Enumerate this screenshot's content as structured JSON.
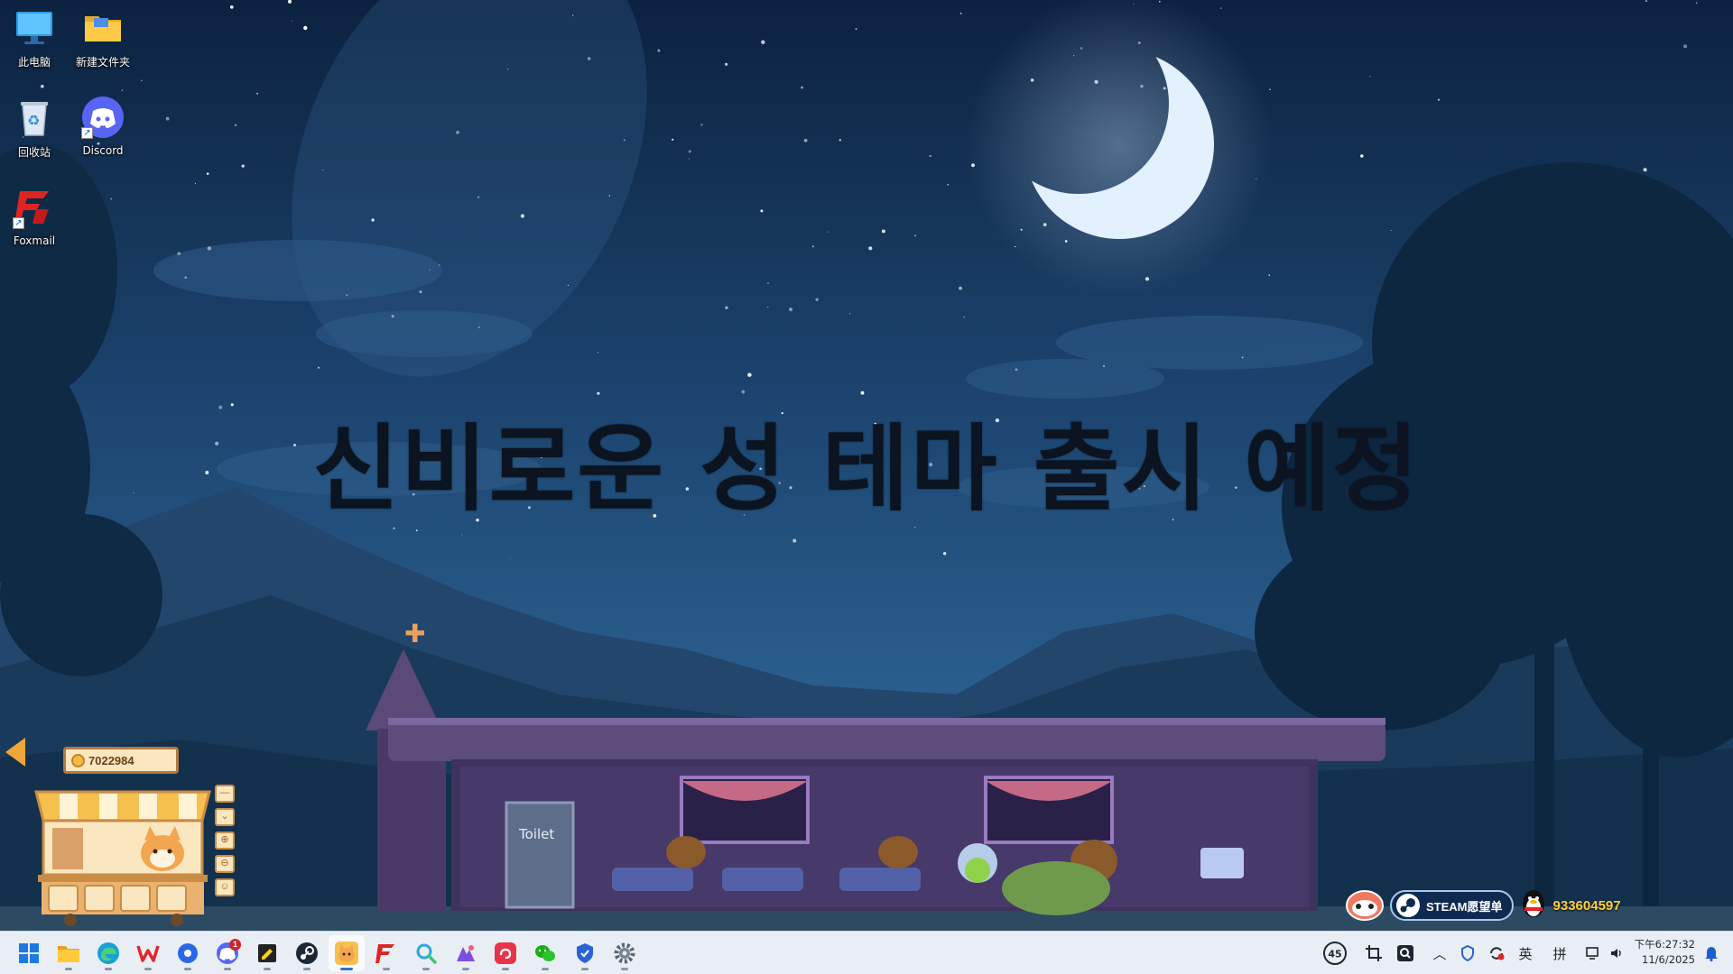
{
  "desktop": {
    "icons": [
      {
        "label": "此电脑",
        "icon": "computer-icon"
      },
      {
        "label": "新建文件夹",
        "icon": "folder-icon"
      },
      {
        "label": "回收站",
        "icon": "recycle-bin-icon"
      },
      {
        "label": "Discord",
        "icon": "discord-icon"
      },
      {
        "label": "Foxmail",
        "icon": "foxmail-icon"
      }
    ]
  },
  "wallpaper": {
    "headline": "신비로운 성 테마 출시 예정",
    "toilet_sign": "Toilet",
    "coins": "7022984"
  },
  "widgets": {
    "steam_label": "STEAM愿望单",
    "qq_number": "933604597"
  },
  "taskbar": {
    "apps": [
      {
        "name": "start",
        "icon": "windows-start-icon"
      },
      {
        "name": "file-explorer",
        "icon": "folder-icon"
      },
      {
        "name": "edge",
        "icon": "edge-icon"
      },
      {
        "name": "wps",
        "icon": "wps-icon"
      },
      {
        "name": "quark",
        "icon": "browser-icon"
      },
      {
        "name": "discord",
        "icon": "discord-icon",
        "badge": "1"
      },
      {
        "name": "sticky-notes",
        "icon": "notes-icon"
      },
      {
        "name": "steam",
        "icon": "steam-icon"
      },
      {
        "name": "pet-game",
        "icon": "cat-icon"
      },
      {
        "name": "foxmail",
        "icon": "foxmail-icon"
      },
      {
        "name": "search-tool",
        "icon": "magnifier-icon"
      },
      {
        "name": "drawing-app",
        "icon": "paint-icon"
      },
      {
        "name": "netease-music",
        "icon": "music-icon"
      },
      {
        "name": "wechat",
        "icon": "wechat-icon"
      },
      {
        "name": "security",
        "icon": "shield-icon"
      },
      {
        "name": "settings",
        "icon": "gear-icon"
      }
    ],
    "tray": {
      "badge_count": "45",
      "ime_lang": "英",
      "ime_mode": "拼",
      "time": "下午6:27:32",
      "date": "11/6/2025"
    }
  },
  "colors": {
    "sky_top": "#0e2440",
    "sky_mid": "#1f4a75",
    "headline": "#0b1420",
    "taskbar": "#e9eef5",
    "accent": "#2f6fd6"
  }
}
